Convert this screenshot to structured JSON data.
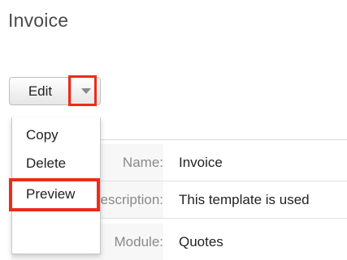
{
  "page": {
    "title": "Invoice"
  },
  "toolbar": {
    "edit_label": "Edit"
  },
  "menu": {
    "items": [
      {
        "label": "Copy"
      },
      {
        "label": "Delete"
      },
      {
        "label": "Preview"
      }
    ]
  },
  "details": {
    "rows": [
      {
        "label": "Name:",
        "value": "Invoice"
      },
      {
        "label": "Description:",
        "value": "This template is used"
      },
      {
        "label": "Module:",
        "value": "Quotes"
      }
    ]
  },
  "colors": {
    "highlight": "#ee2a1b"
  }
}
